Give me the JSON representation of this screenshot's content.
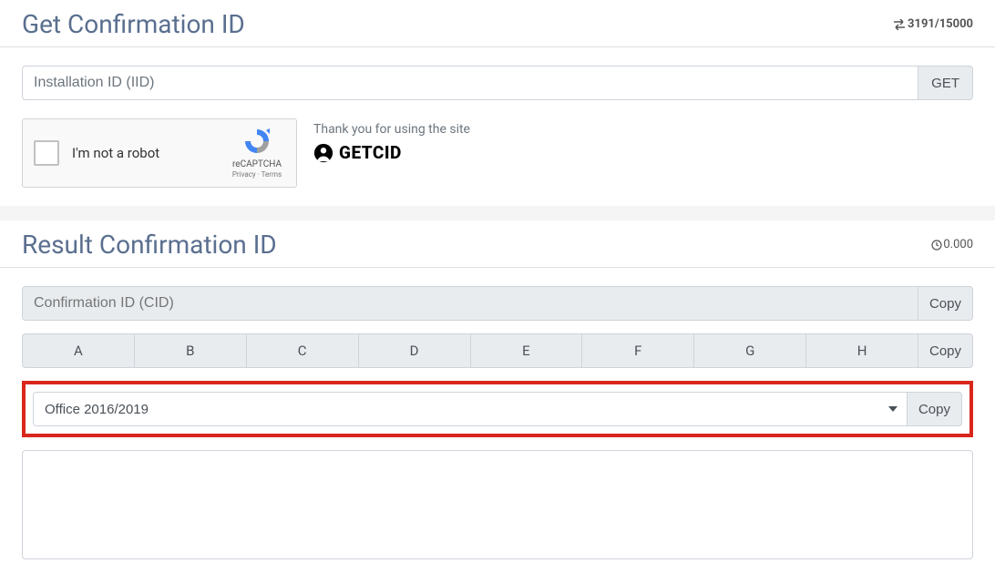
{
  "section_get": {
    "title": "Get Confirmation ID",
    "counter": "3191/15000",
    "iid_placeholder": "Installation ID (IID)",
    "get_btn": "GET",
    "recaptcha": {
      "label": "I'm not a robot",
      "brand": "reCAPTCHA",
      "links": "Privacy · Terms"
    },
    "thankyou": "Thank you for using the site",
    "brand_name": "GETCID"
  },
  "section_result": {
    "title": "Result Confirmation ID",
    "timer": "0.000",
    "cid_placeholder": "Confirmation ID (CID)",
    "copy_btn": "Copy",
    "letters": [
      "A",
      "B",
      "C",
      "D",
      "E",
      "F",
      "G",
      "H"
    ],
    "product_selected": "Office 2016/2019",
    "textarea_value": ""
  }
}
